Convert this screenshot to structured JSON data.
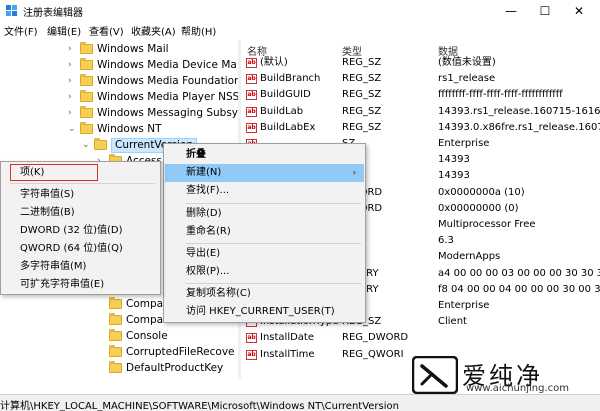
{
  "window": {
    "title": "注册表编辑器",
    "minimize": "—",
    "maximize": "☐",
    "close": "✕"
  },
  "menu": [
    "文件(F)",
    "编辑(E)",
    "查看(V)",
    "收藏夹(A)",
    "帮助(H)"
  ],
  "tree": [
    {
      "label": "Windows Mail",
      "chev": "›"
    },
    {
      "label": "Windows Media Device Ma",
      "chev": "›"
    },
    {
      "label": "Windows Media Foundatior",
      "chev": "›"
    },
    {
      "label": "Windows Media Player NSS",
      "chev": "›"
    },
    {
      "label": "Windows Messaging Subsy",
      "chev": "›"
    },
    {
      "label": "Windows NT",
      "chev": "⌄"
    },
    {
      "label": "CurrentVersion",
      "chev": "⌄",
      "selected": true
    },
    {
      "label": "Accessi",
      "chev": "›"
    },
    {
      "label": "Compa",
      "chev": ""
    },
    {
      "label": "Compa",
      "chev": ""
    },
    {
      "label": "Console",
      "chev": ""
    },
    {
      "label": "CorruptedFileRecove",
      "chev": ""
    },
    {
      "label": "DefaultProductKey",
      "chev": ""
    }
  ],
  "list": {
    "headers": {
      "name": "名称",
      "type": "类型",
      "data": "数据"
    },
    "rows": [
      {
        "name": "(默认)",
        "type": "REG_SZ",
        "data": "(数值未设置)"
      },
      {
        "name": "BuildBranch",
        "type": "REG_SZ",
        "data": "rs1_release"
      },
      {
        "name": "BuildGUID",
        "type": "REG_SZ",
        "data": "ffffffff-ffff-ffff-ffff-ffffffffffff"
      },
      {
        "name": "BuildLab",
        "type": "REG_SZ",
        "data": "14393.rs1_release.160715-1616"
      },
      {
        "name": "BuildLabEx",
        "type": "REG_SZ",
        "data": "14393.0.x86fre.rs1_release.1607"
      },
      {
        "name": "",
        "type": "SZ",
        "data": "Enterprise"
      },
      {
        "name": "",
        "type": "SZ",
        "data": "14393"
      },
      {
        "name": "",
        "type": "SZ",
        "data": "14393"
      },
      {
        "name": "",
        "type": "DWORD",
        "data": "0x0000000a (10)"
      },
      {
        "name": "",
        "type": "DWORD",
        "data": "0x00000000 (0)"
      },
      {
        "name": "",
        "type": "SZ",
        "data": "Multiprocessor Free"
      },
      {
        "name": "",
        "type": "SZ",
        "data": "6.3"
      },
      {
        "name": "",
        "type": "SZ",
        "data": "ModernApps"
      },
      {
        "name": "",
        "type": "BINARY",
        "data": "a4 00 00 00 03 00 00 00 30 30 3"
      },
      {
        "name": "",
        "type": "BINARY",
        "data": "f8 04 00 00 04 00 00 00 30 00 3"
      },
      {
        "name": "",
        "type": "SZ",
        "data": "Enterprise"
      },
      {
        "name": "InstallationType",
        "type": "REG_SZ",
        "data": "Client"
      },
      {
        "name": "InstallDate",
        "type": "REG_DWORD",
        "data": ""
      },
      {
        "name": "InstallTime",
        "type": "REG_QWORI",
        "data": ""
      }
    ]
  },
  "context_menu": {
    "items": [
      {
        "label": "折叠",
        "style": "bold"
      },
      {
        "label": "新建(N)",
        "style": "highlight",
        "arrow": "›"
      },
      {
        "label": "查找(F)...",
        "style": ""
      },
      {
        "label": "删除(D)",
        "style": ""
      },
      {
        "label": "重命名(R)",
        "style": ""
      },
      {
        "label": "导出(E)",
        "style": ""
      },
      {
        "label": "权限(P)...",
        "style": ""
      },
      {
        "label": "复制项名称(C)",
        "style": ""
      },
      {
        "label": "访问 HKEY_CURRENT_USER(T)",
        "style": ""
      }
    ]
  },
  "submenu": {
    "items": [
      "项(K)",
      "字符串值(S)",
      "二进制值(B)",
      "DWORD (32 位)值(D)",
      "QWORD (64 位)值(Q)",
      "多字符串值(M)",
      "可扩充字符串值(E)"
    ]
  },
  "status": {
    "path": "计算机\\HKEY_LOCAL_MACHINE\\SOFTWARE\\Microsoft\\Windows NT\\CurrentVersion"
  },
  "watermark": {
    "brand": "爱纯净",
    "url": "www.aichunjing.com"
  },
  "colors": {
    "highlight": "#91c9f7",
    "annotation_box": "#d9312a",
    "selected_bg": "#cce8ff"
  }
}
